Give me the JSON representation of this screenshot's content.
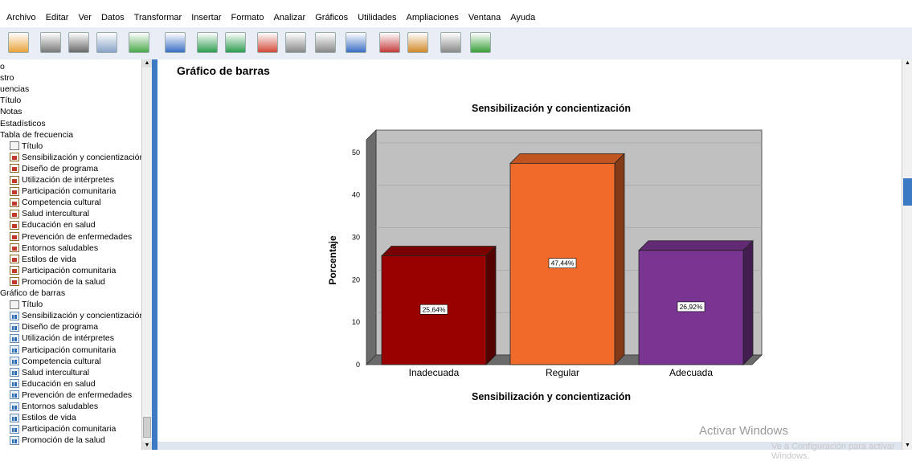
{
  "menu": [
    "Archivo",
    "Editar",
    "Ver",
    "Datos",
    "Transformar",
    "Insertar",
    "Formato",
    "Analizar",
    "Gráficos",
    "Utilidades",
    "Ampliaciones",
    "Ventana",
    "Ayuda"
  ],
  "toolbar_icons": [
    "open-icon",
    "save-icon",
    "print-icon",
    "print-preview-icon",
    "export-icon",
    "dialog-recall-icon",
    "undo-icon",
    "redo-icon",
    "goto-case-icon",
    "goto-variable-icon",
    "insert-case-icon",
    "variables-icon",
    "script-icon",
    "designate-window-icon",
    "select-output-icon",
    "add-item-icon"
  ],
  "nav": {
    "items": [
      {
        "label": "o",
        "icon": "none",
        "level": 0
      },
      {
        "label": "stro",
        "icon": "none",
        "level": 0
      },
      {
        "label": "uencias",
        "icon": "none",
        "level": 0
      },
      {
        "label": "Título",
        "icon": "none",
        "level": 0
      },
      {
        "label": "Notas",
        "icon": "none",
        "level": 0
      },
      {
        "label": "Estadísticos",
        "icon": "none",
        "level": 0
      },
      {
        "label": "Tabla de frecuencia",
        "icon": "none",
        "level": 0
      },
      {
        "label": "Título",
        "icon": "title",
        "level": 1
      },
      {
        "label": "Sensibilización y concientización",
        "icon": "table",
        "level": 1
      },
      {
        "label": "Diseño de programa",
        "icon": "table",
        "level": 1
      },
      {
        "label": "Utilización de intérpretes",
        "icon": "table",
        "level": 1
      },
      {
        "label": "Participación comunitaria",
        "icon": "table",
        "level": 1
      },
      {
        "label": "Competencia cultural",
        "icon": "table",
        "level": 1
      },
      {
        "label": "Salud intercultural",
        "icon": "table",
        "level": 1
      },
      {
        "label": "Educación en salud",
        "icon": "table",
        "level": 1
      },
      {
        "label": "Prevención de enfermedades",
        "icon": "table",
        "level": 1
      },
      {
        "label": "Entornos saludables",
        "icon": "table",
        "level": 1
      },
      {
        "label": "Estilos de vida",
        "icon": "table",
        "level": 1
      },
      {
        "label": "Participación comunitaria",
        "icon": "table",
        "level": 1
      },
      {
        "label": "Promoción de la salud",
        "icon": "table",
        "level": 1
      },
      {
        "label": "Gráfico de barras",
        "icon": "none",
        "level": 0
      },
      {
        "label": "Título",
        "icon": "title",
        "level": 1
      },
      {
        "label": "Sensibilización y concientización",
        "icon": "chart",
        "level": 1
      },
      {
        "label": "Diseño de programa",
        "icon": "chart",
        "level": 1
      },
      {
        "label": "Utilización de intérpretes",
        "icon": "chart",
        "level": 1
      },
      {
        "label": "Participación comunitaria",
        "icon": "chart",
        "level": 1
      },
      {
        "label": "Competencia cultural",
        "icon": "chart",
        "level": 1
      },
      {
        "label": "Salud intercultural",
        "icon": "chart",
        "level": 1
      },
      {
        "label": "Educación en salud",
        "icon": "chart",
        "level": 1
      },
      {
        "label": "Prevención de enfermedades",
        "icon": "chart",
        "level": 1
      },
      {
        "label": "Entornos saludables",
        "icon": "chart",
        "level": 1
      },
      {
        "label": "Estilos de vida",
        "icon": "chart",
        "level": 1
      },
      {
        "label": "Participación comunitaria",
        "icon": "chart",
        "level": 1
      },
      {
        "label": "Promoción de la salud",
        "icon": "chart",
        "level": 1
      }
    ]
  },
  "output": {
    "heading": "Gráfico de barras"
  },
  "chart_data": {
    "type": "bar",
    "title": "Sensibilización y concientización",
    "xlabel": "Sensibilización y concientización",
    "ylabel": "Porcentaje",
    "categories": [
      "Inadecuada",
      "Regular",
      "Adecuada"
    ],
    "values": [
      25.64,
      47.44,
      26.92
    ],
    "data_labels": [
      "25,64%",
      "47,44%",
      "26,92%"
    ],
    "colors": [
      "#990000",
      "#f06a2a",
      "#7a3592"
    ],
    "yticks": [
      0,
      10,
      20,
      30,
      40,
      50
    ],
    "ylim": [
      0,
      53
    ],
    "style": "3d",
    "background": "#c0c0c0"
  },
  "watermark": {
    "line1": "Activar Windows",
    "line2": "Ve a Configuración para activar Windows."
  }
}
